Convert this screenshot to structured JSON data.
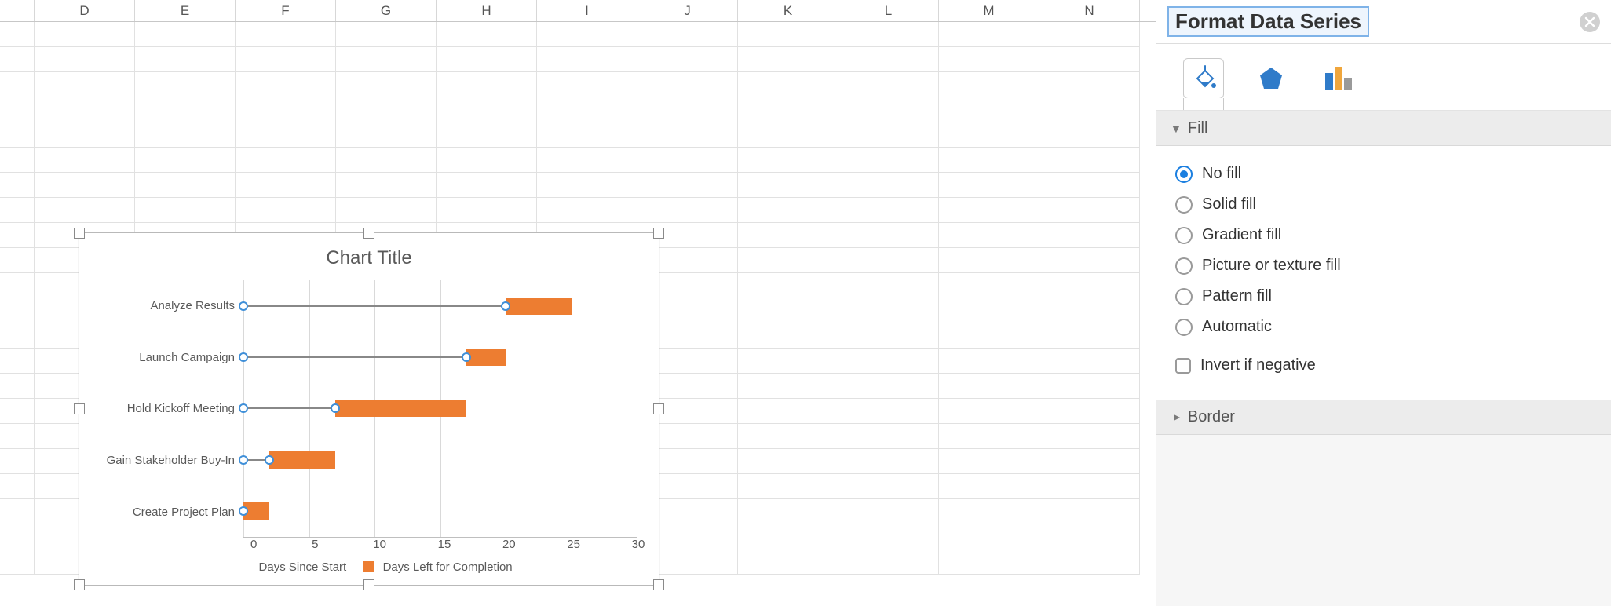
{
  "columns": [
    "D",
    "E",
    "F",
    "G",
    "H",
    "I",
    "J",
    "K",
    "L",
    "M",
    "N"
  ],
  "row_count": 22,
  "chart_data": {
    "type": "bar",
    "orientation": "horizontal",
    "title": "Chart Title",
    "xlabel": "",
    "ylabel": "",
    "xlim": [
      0,
      30
    ],
    "x_ticks": [
      0,
      5,
      10,
      15,
      20,
      25,
      30
    ],
    "categories": [
      "Analyze Results",
      "Launch Campaign",
      "Hold Kickoff Meeting",
      "Gain Stakeholder Buy-In",
      "Create Project Plan"
    ],
    "series": [
      {
        "name": "Days Since Start",
        "values": [
          20,
          17,
          7,
          2,
          0
        ],
        "selected": true,
        "fill": "none"
      },
      {
        "name": "Days Left for Completion",
        "values": [
          5,
          3,
          10,
          5,
          2
        ],
        "fill": "#ed7d31"
      }
    ],
    "legend": {
      "position": "bottom"
    }
  },
  "panel": {
    "title": "Format Data Series",
    "tabs": {
      "fill_line": "Fill & Line",
      "effects": "Effects",
      "series_options": "Series Options",
      "active": "fill_line"
    },
    "sections": {
      "fill": {
        "label": "Fill",
        "expanded": true,
        "options": {
          "no_fill": "No fill",
          "solid_fill": "Solid fill",
          "gradient_fill": "Gradient fill",
          "picture_fill": "Picture or texture fill",
          "pattern_fill": "Pattern fill",
          "automatic": "Automatic"
        },
        "selected": "no_fill",
        "invert_label": "Invert if negative",
        "invert_checked": false
      },
      "border": {
        "label": "Border",
        "expanded": false
      }
    }
  }
}
